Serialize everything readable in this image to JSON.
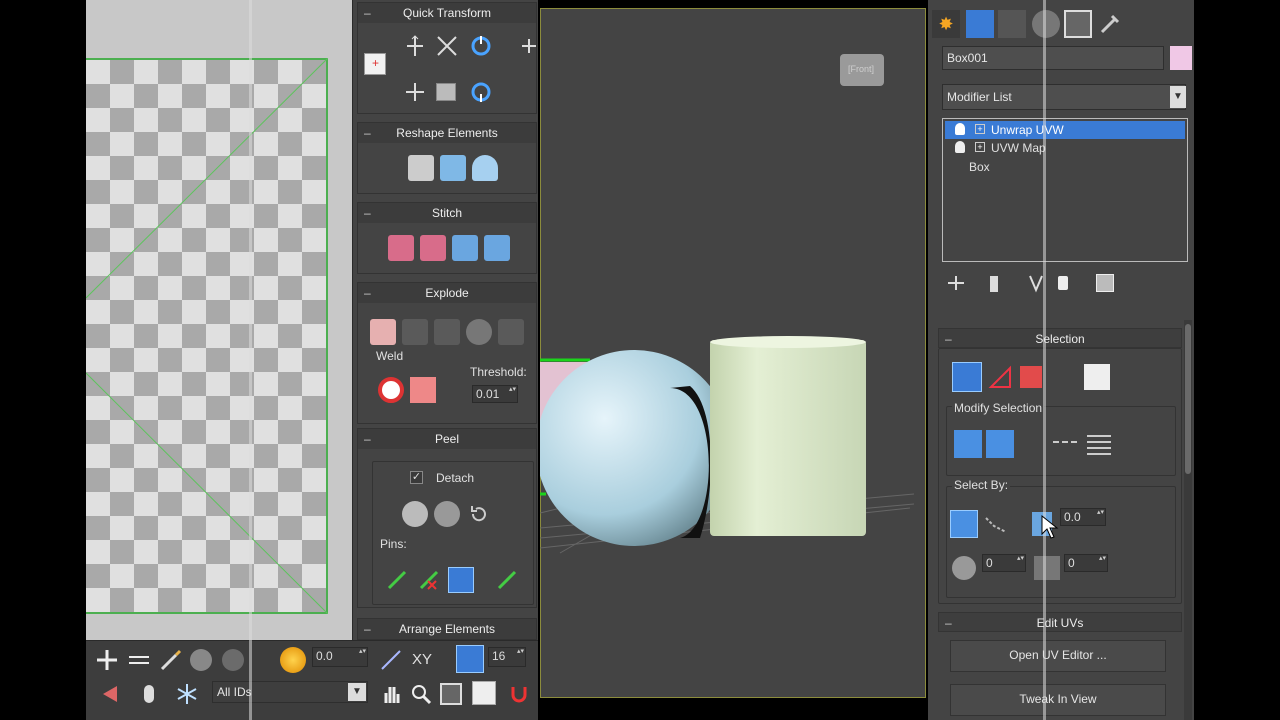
{
  "uv_editor": {},
  "unwrap_panel": {
    "quick_transform": "Quick Transform",
    "reshape_elements": "Reshape Elements",
    "stitch": "Stitch",
    "explode": "Explode",
    "weld_label": "Weld",
    "threshold_label": "Threshold:",
    "threshold_value": "0.01",
    "peel": "Peel",
    "detach_label": "Detach",
    "pins_label": "Pins:",
    "arrange_elements": "Arrange Elements"
  },
  "viewport": {
    "viewcube_label": "[Front]"
  },
  "bottom_toolbar": {
    "spinner_value": "0.0",
    "xy_label": "XY",
    "grid_value": "16",
    "ids_dropdown": "All IDs"
  },
  "command_panel": {
    "object_name": "Box001",
    "object_color": "#f0c8e6",
    "modifier_list": "Modifier List",
    "stack": [
      {
        "label": "Unwrap UVW",
        "selected": true
      },
      {
        "label": "UVW Map",
        "selected": false
      },
      {
        "label": "Box",
        "selected": false
      }
    ],
    "selection_title": "Selection",
    "modify_selection": "Modify Selection",
    "select_by": "Select By:",
    "angle_value": "0.0",
    "ring_value": "0",
    "loop_value": "0",
    "edit_uvs_title": "Edit UVs",
    "open_uv_editor": "Open UV Editor ...",
    "tweak_in_view": "Tweak In View"
  },
  "colors": {
    "accent_blue": "#3a7bd5",
    "uv_green": "#4caf50",
    "viewport_border": "#8c8c3c",
    "sphere": "#b9d8e6",
    "cylinder": "#dceac8"
  }
}
